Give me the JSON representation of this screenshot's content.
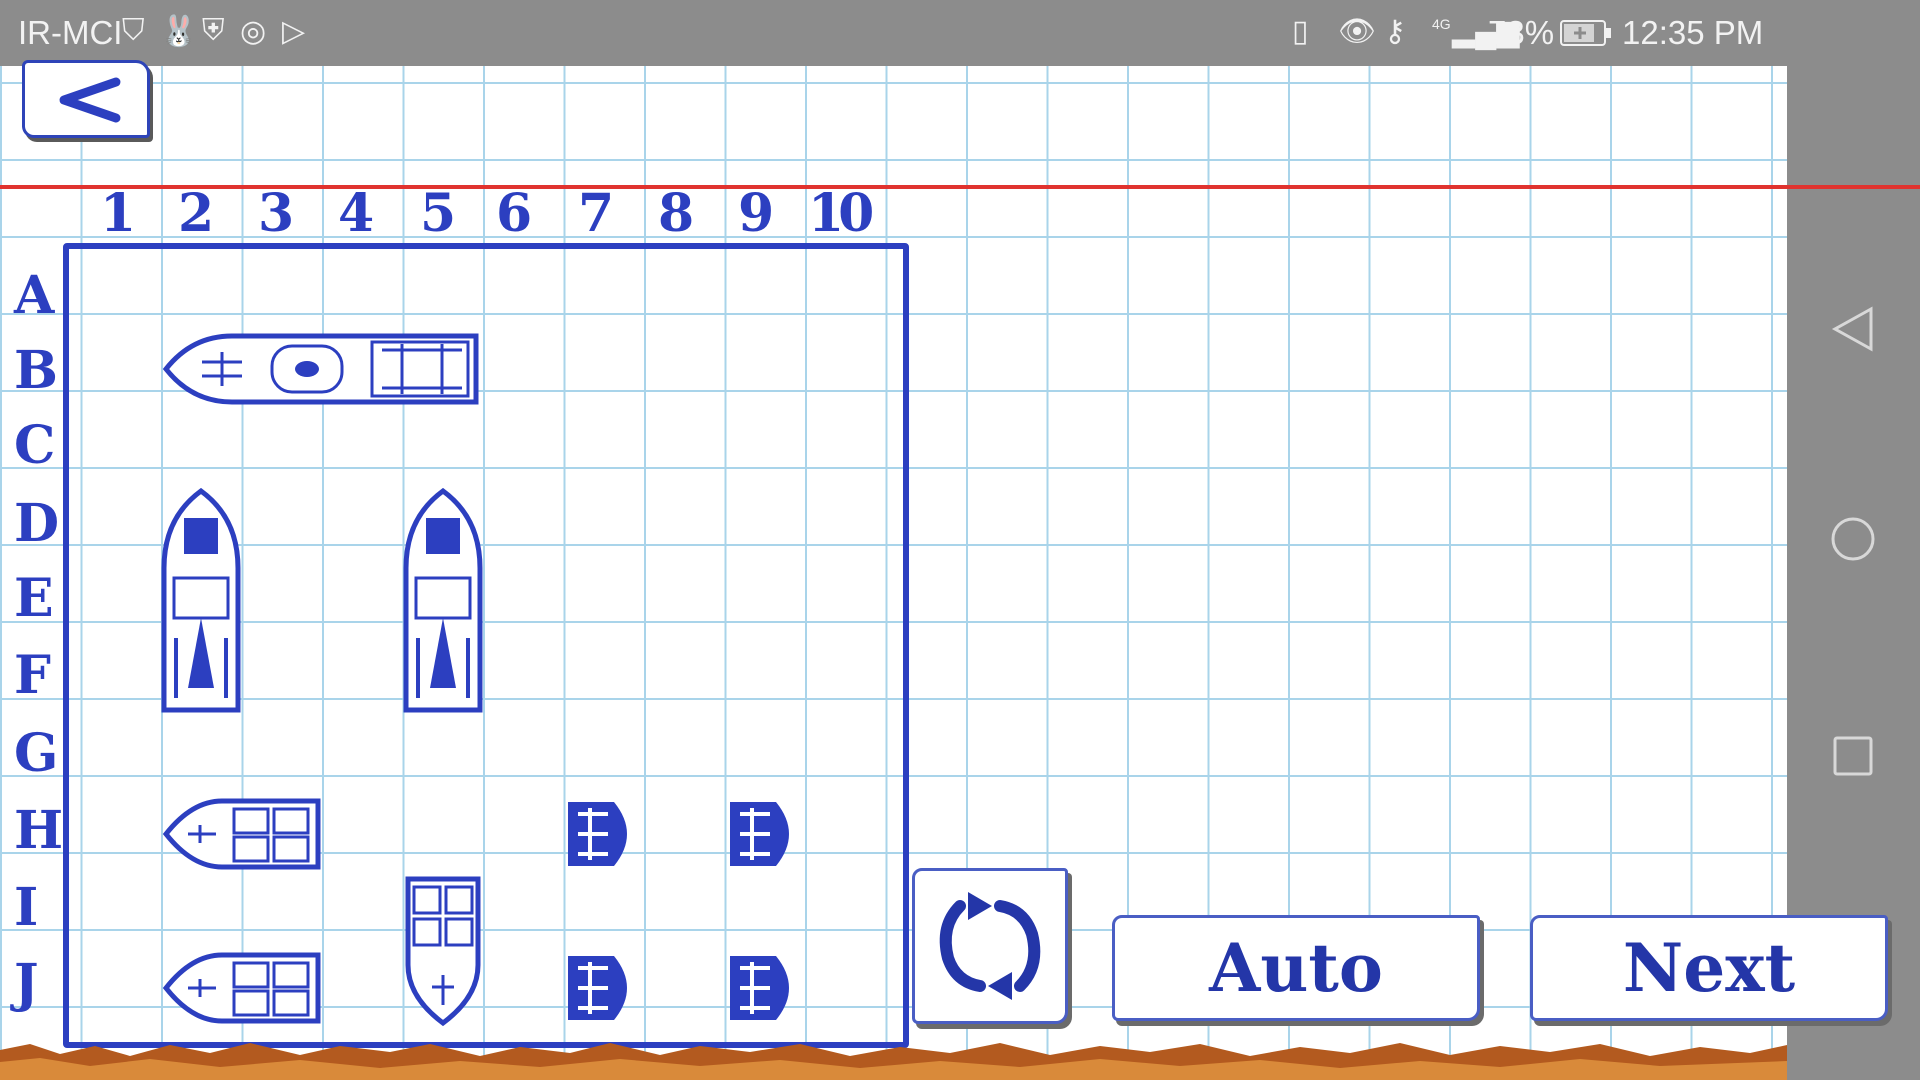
{
  "status_bar": {
    "carrier": "IR-MCI",
    "battery": "73%",
    "network": "4G",
    "time": "12:35 PM",
    "icons": [
      "usb-icon",
      "rabbit-app-icon",
      "shield-icon",
      "mci-app-icon",
      "play-store-icon",
      "vibrate-icon",
      "eye-icon",
      "key-icon",
      "signal-icon",
      "battery-charging-icon"
    ]
  },
  "nav_bar": {
    "icons": [
      "back-triangle-icon",
      "home-circle-icon",
      "recents-square-icon"
    ]
  },
  "board": {
    "columns": [
      "1",
      "2",
      "3",
      "4",
      "5",
      "6",
      "7",
      "8",
      "9",
      "10"
    ],
    "rows": [
      "A",
      "B",
      "C",
      "D",
      "E",
      "F",
      "G",
      "H",
      "I",
      "J"
    ],
    "ink_color": "#2c3fc0",
    "ships": [
      {
        "name": "carrier",
        "start": "B2",
        "end": "B5",
        "length": 4,
        "orientation": "horizontal"
      },
      {
        "name": "battleship-1",
        "start": "D2",
        "end": "F2",
        "length": 3,
        "orientation": "vertical"
      },
      {
        "name": "battleship-2",
        "start": "D5",
        "end": "F5",
        "length": 3,
        "orientation": "vertical"
      },
      {
        "name": "destroyer-1",
        "start": "H2",
        "end": "H3",
        "length": 2,
        "orientation": "horizontal"
      },
      {
        "name": "destroyer-2",
        "start": "J2",
        "end": "J3",
        "length": 2,
        "orientation": "horizontal"
      },
      {
        "name": "destroyer-3",
        "start": "I5",
        "end": "J5",
        "length": 2,
        "orientation": "vertical"
      },
      {
        "name": "boat-1",
        "start": "H7",
        "length": 1
      },
      {
        "name": "boat-2",
        "start": "H9",
        "length": 1
      },
      {
        "name": "boat-3",
        "start": "J7",
        "length": 1
      },
      {
        "name": "boat-4",
        "start": "J9",
        "length": 1
      }
    ]
  },
  "buttons": {
    "back_icon": "back-arrow-icon",
    "rotate_icon": "rotate-icon",
    "auto_label": "Auto",
    "next_label": "Next"
  }
}
